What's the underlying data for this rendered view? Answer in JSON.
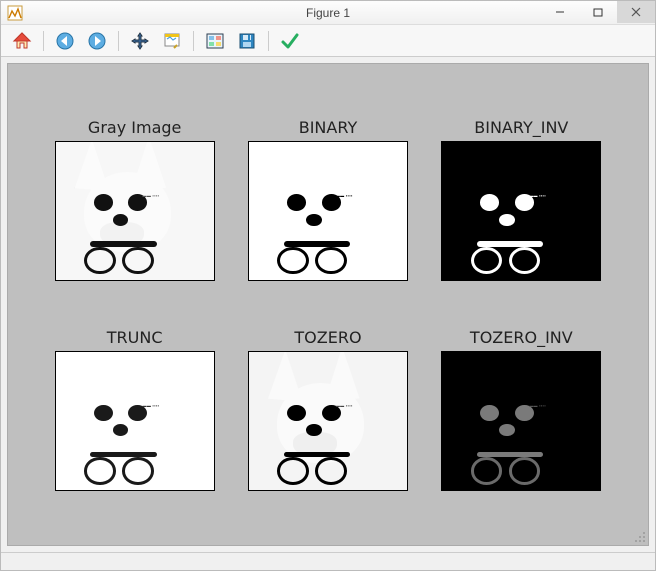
{
  "window": {
    "title": "Figure 1"
  },
  "toolbar": {
    "icons": [
      "home",
      "back",
      "forward",
      "pan",
      "zoom",
      "subplots",
      "save",
      "check"
    ]
  },
  "subplots": [
    {
      "title": "Gray Image",
      "variant": "gray"
    },
    {
      "title": "BINARY",
      "variant": "bin"
    },
    {
      "title": "BINARY_INV",
      "variant": "bininv"
    },
    {
      "title": "TRUNC",
      "variant": "trunc"
    },
    {
      "title": "TOZERO",
      "variant": "tozero"
    },
    {
      "title": "TOZERO_INV",
      "variant": "tozeroinv"
    }
  ],
  "chart_data": {
    "type": "table",
    "title": "Figure 1",
    "description": "2×3 grid of grayscale/threshold variants of the same chihuahua photo (dog holding glasses in mouth)",
    "rows": 2,
    "cols": 3,
    "panels": [
      {
        "row": 0,
        "col": 0,
        "title": "Gray Image",
        "mode": "grayscale",
        "background": "light",
        "features_dark": [
          "eyes",
          "nose",
          "glasses",
          "watermark"
        ]
      },
      {
        "row": 0,
        "col": 1,
        "title": "BINARY",
        "mode": "THRESH_BINARY",
        "background": "white",
        "features_dark": [
          "eyes",
          "nose",
          "glasses",
          "watermark"
        ]
      },
      {
        "row": 0,
        "col": 2,
        "title": "BINARY_INV",
        "mode": "THRESH_BINARY_INV",
        "background": "black",
        "features_light": [
          "eyes",
          "nose",
          "glasses",
          "watermark"
        ]
      },
      {
        "row": 1,
        "col": 0,
        "title": "TRUNC",
        "mode": "THRESH_TRUNC",
        "background": "white",
        "features_dark": [
          "eyes",
          "nose",
          "glasses",
          "watermark"
        ]
      },
      {
        "row": 1,
        "col": 1,
        "title": "TOZERO",
        "mode": "THRESH_TOZERO",
        "background": "light",
        "features_dark": [
          "eyes",
          "nose",
          "glasses",
          "watermark"
        ]
      },
      {
        "row": 1,
        "col": 2,
        "title": "TOZERO_INV",
        "mode": "THRESH_TOZERO_INV",
        "background": "black",
        "features_gray": [
          "eyes",
          "nose",
          "glasses",
          "watermark"
        ]
      }
    ]
  }
}
